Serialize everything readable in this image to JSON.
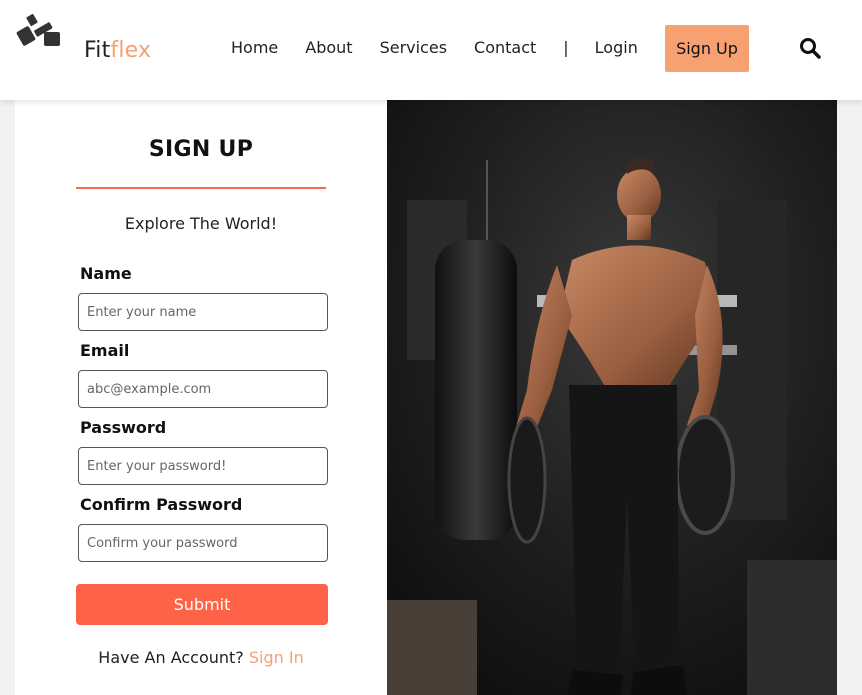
{
  "header": {
    "brand_part1": "Fit",
    "brand_part2": "flex",
    "nav": [
      "Home",
      "About",
      "Services",
      "Contact"
    ],
    "separator": "|",
    "login": "Login",
    "signup": "Sign Up"
  },
  "form": {
    "title": "SIGN UP",
    "tagline": "Explore The World!",
    "fields": [
      {
        "label": "Name",
        "placeholder": "Enter your name"
      },
      {
        "label": "Email",
        "placeholder": "abc@example.com"
      },
      {
        "label": "Password",
        "placeholder": "Enter your password!"
      },
      {
        "label": "Confirm Password",
        "placeholder": "Confirm your password"
      }
    ],
    "submit": "Submit",
    "account_prompt": "Have An Account?",
    "signin": "Sign In"
  },
  "colors": {
    "accent": "#f7a072",
    "submit": "#ff6347",
    "underline": "#f26b4f"
  },
  "icons": [
    "dumbbell-icon",
    "search-icon"
  ]
}
